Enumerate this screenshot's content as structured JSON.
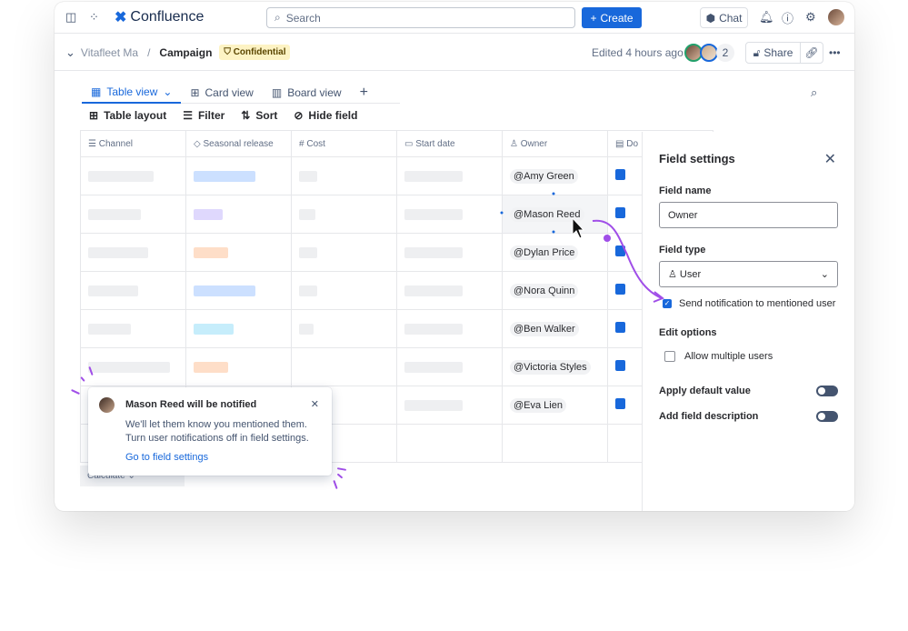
{
  "topbar": {
    "app": "Confluence",
    "search_placeholder": "Search",
    "create": "Create",
    "chat": "Chat"
  },
  "breadcrumb": {
    "space": "Vitafleet Ma",
    "page": "Campaign",
    "badge": "Confidential",
    "edited": "Edited 4 hours ago",
    "collaborator_count": "2",
    "share": "Share"
  },
  "views": {
    "tabs": [
      "Table view",
      "Card view",
      "Board view"
    ]
  },
  "toolbar": {
    "layout": "Table layout",
    "filter": "Filter",
    "sort": "Sort",
    "hide": "Hide field"
  },
  "table": {
    "columns": [
      "Channel",
      "Seasonal release",
      "Cost",
      "Start date",
      "Owner",
      "Do"
    ],
    "owners": [
      "@Amy Green",
      "@Mason Reed",
      "@Dylan Price",
      "@Nora Quinn",
      "@Ben Walker",
      "@Victoria Styles",
      "@Eva Lien"
    ],
    "release_colors": [
      "#cce0ff",
      "#dfd8fd",
      "#fedec8",
      "#cce0ff",
      "#c6edfb",
      "#fedec8"
    ],
    "calculate": "Calculate"
  },
  "panel": {
    "title": "Field settings",
    "name_label": "Field name",
    "name_value": "Owner",
    "type_label": "Field type",
    "type_value": "User",
    "send_notification": "Send notification to mentioned user",
    "send_checked": true,
    "edit_options": "Edit options",
    "allow_multiple": "Allow multiple users",
    "allow_checked": false,
    "apply_default": "Apply default value",
    "apply_default_on": false,
    "add_description": "Add field description",
    "add_description_on": false
  },
  "toast": {
    "title": "Mason Reed will be notified",
    "line1": "We'll let them know you mentioned them.",
    "line2": "Turn user notifications off in field settings.",
    "link": "Go to field settings"
  }
}
